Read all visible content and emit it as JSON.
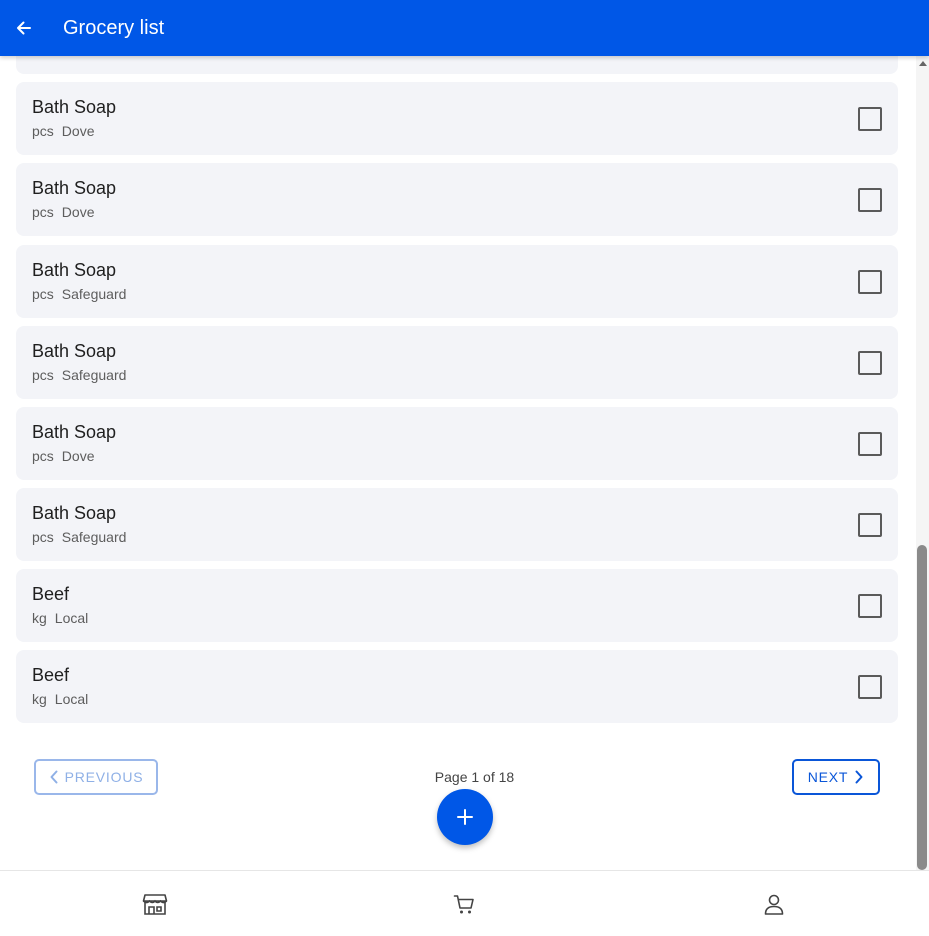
{
  "app_bar": {
    "title": "Grocery list",
    "back_icon": "arrow-left-icon",
    "color": "#0057e7"
  },
  "items": [
    {
      "name": "Bath Soap",
      "unit": "pcs",
      "brand": "Dove",
      "checked": false
    },
    {
      "name": "Bath Soap",
      "unit": "pcs",
      "brand": "Dove",
      "checked": false
    },
    {
      "name": "Bath Soap",
      "unit": "pcs",
      "brand": "Safeguard",
      "checked": false
    },
    {
      "name": "Bath Soap",
      "unit": "pcs",
      "brand": "Safeguard",
      "checked": false
    },
    {
      "name": "Bath Soap",
      "unit": "pcs",
      "brand": "Dove",
      "checked": false
    },
    {
      "name": "Bath Soap",
      "unit": "pcs",
      "brand": "Safeguard",
      "checked": false
    },
    {
      "name": "Beef",
      "unit": "kg",
      "brand": "Local",
      "checked": false
    },
    {
      "name": "Beef",
      "unit": "kg",
      "brand": "Local",
      "checked": false
    }
  ],
  "pagination": {
    "previous_label": "PREVIOUS",
    "next_label": "NEXT",
    "page_label": "Page 1 of 18",
    "previous_enabled": false
  },
  "fab": {
    "icon": "plus-icon"
  },
  "bottom_nav": [
    {
      "icon": "store-icon"
    },
    {
      "icon": "cart-icon"
    },
    {
      "icon": "user-icon"
    }
  ]
}
